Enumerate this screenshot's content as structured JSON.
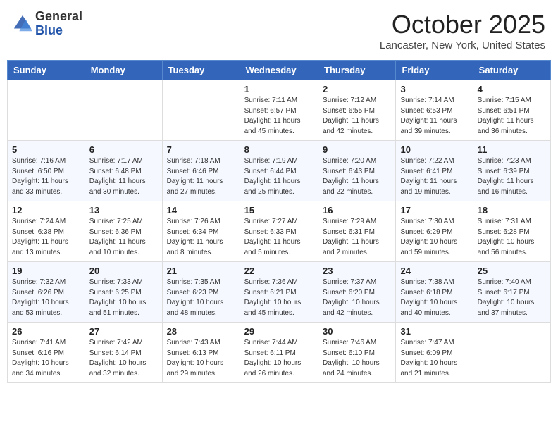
{
  "header": {
    "logo_general": "General",
    "logo_blue": "Blue",
    "month_title": "October 2025",
    "location": "Lancaster, New York, United States"
  },
  "days_of_week": [
    "Sunday",
    "Monday",
    "Tuesday",
    "Wednesday",
    "Thursday",
    "Friday",
    "Saturday"
  ],
  "weeks": [
    [
      {
        "day": "",
        "info": ""
      },
      {
        "day": "",
        "info": ""
      },
      {
        "day": "",
        "info": ""
      },
      {
        "day": "1",
        "info": "Sunrise: 7:11 AM\nSunset: 6:57 PM\nDaylight: 11 hours and 45 minutes."
      },
      {
        "day": "2",
        "info": "Sunrise: 7:12 AM\nSunset: 6:55 PM\nDaylight: 11 hours and 42 minutes."
      },
      {
        "day": "3",
        "info": "Sunrise: 7:14 AM\nSunset: 6:53 PM\nDaylight: 11 hours and 39 minutes."
      },
      {
        "day": "4",
        "info": "Sunrise: 7:15 AM\nSunset: 6:51 PM\nDaylight: 11 hours and 36 minutes."
      }
    ],
    [
      {
        "day": "5",
        "info": "Sunrise: 7:16 AM\nSunset: 6:50 PM\nDaylight: 11 hours and 33 minutes."
      },
      {
        "day": "6",
        "info": "Sunrise: 7:17 AM\nSunset: 6:48 PM\nDaylight: 11 hours and 30 minutes."
      },
      {
        "day": "7",
        "info": "Sunrise: 7:18 AM\nSunset: 6:46 PM\nDaylight: 11 hours and 27 minutes."
      },
      {
        "day": "8",
        "info": "Sunrise: 7:19 AM\nSunset: 6:44 PM\nDaylight: 11 hours and 25 minutes."
      },
      {
        "day": "9",
        "info": "Sunrise: 7:20 AM\nSunset: 6:43 PM\nDaylight: 11 hours and 22 minutes."
      },
      {
        "day": "10",
        "info": "Sunrise: 7:22 AM\nSunset: 6:41 PM\nDaylight: 11 hours and 19 minutes."
      },
      {
        "day": "11",
        "info": "Sunrise: 7:23 AM\nSunset: 6:39 PM\nDaylight: 11 hours and 16 minutes."
      }
    ],
    [
      {
        "day": "12",
        "info": "Sunrise: 7:24 AM\nSunset: 6:38 PM\nDaylight: 11 hours and 13 minutes."
      },
      {
        "day": "13",
        "info": "Sunrise: 7:25 AM\nSunset: 6:36 PM\nDaylight: 11 hours and 10 minutes."
      },
      {
        "day": "14",
        "info": "Sunrise: 7:26 AM\nSunset: 6:34 PM\nDaylight: 11 hours and 8 minutes."
      },
      {
        "day": "15",
        "info": "Sunrise: 7:27 AM\nSunset: 6:33 PM\nDaylight: 11 hours and 5 minutes."
      },
      {
        "day": "16",
        "info": "Sunrise: 7:29 AM\nSunset: 6:31 PM\nDaylight: 11 hours and 2 minutes."
      },
      {
        "day": "17",
        "info": "Sunrise: 7:30 AM\nSunset: 6:29 PM\nDaylight: 10 hours and 59 minutes."
      },
      {
        "day": "18",
        "info": "Sunrise: 7:31 AM\nSunset: 6:28 PM\nDaylight: 10 hours and 56 minutes."
      }
    ],
    [
      {
        "day": "19",
        "info": "Sunrise: 7:32 AM\nSunset: 6:26 PM\nDaylight: 10 hours and 53 minutes."
      },
      {
        "day": "20",
        "info": "Sunrise: 7:33 AM\nSunset: 6:25 PM\nDaylight: 10 hours and 51 minutes."
      },
      {
        "day": "21",
        "info": "Sunrise: 7:35 AM\nSunset: 6:23 PM\nDaylight: 10 hours and 48 minutes."
      },
      {
        "day": "22",
        "info": "Sunrise: 7:36 AM\nSunset: 6:21 PM\nDaylight: 10 hours and 45 minutes."
      },
      {
        "day": "23",
        "info": "Sunrise: 7:37 AM\nSunset: 6:20 PM\nDaylight: 10 hours and 42 minutes."
      },
      {
        "day": "24",
        "info": "Sunrise: 7:38 AM\nSunset: 6:18 PM\nDaylight: 10 hours and 40 minutes."
      },
      {
        "day": "25",
        "info": "Sunrise: 7:40 AM\nSunset: 6:17 PM\nDaylight: 10 hours and 37 minutes."
      }
    ],
    [
      {
        "day": "26",
        "info": "Sunrise: 7:41 AM\nSunset: 6:16 PM\nDaylight: 10 hours and 34 minutes."
      },
      {
        "day": "27",
        "info": "Sunrise: 7:42 AM\nSunset: 6:14 PM\nDaylight: 10 hours and 32 minutes."
      },
      {
        "day": "28",
        "info": "Sunrise: 7:43 AM\nSunset: 6:13 PM\nDaylight: 10 hours and 29 minutes."
      },
      {
        "day": "29",
        "info": "Sunrise: 7:44 AM\nSunset: 6:11 PM\nDaylight: 10 hours and 26 minutes."
      },
      {
        "day": "30",
        "info": "Sunrise: 7:46 AM\nSunset: 6:10 PM\nDaylight: 10 hours and 24 minutes."
      },
      {
        "day": "31",
        "info": "Sunrise: 7:47 AM\nSunset: 6:09 PM\nDaylight: 10 hours and 21 minutes."
      },
      {
        "day": "",
        "info": ""
      }
    ]
  ]
}
